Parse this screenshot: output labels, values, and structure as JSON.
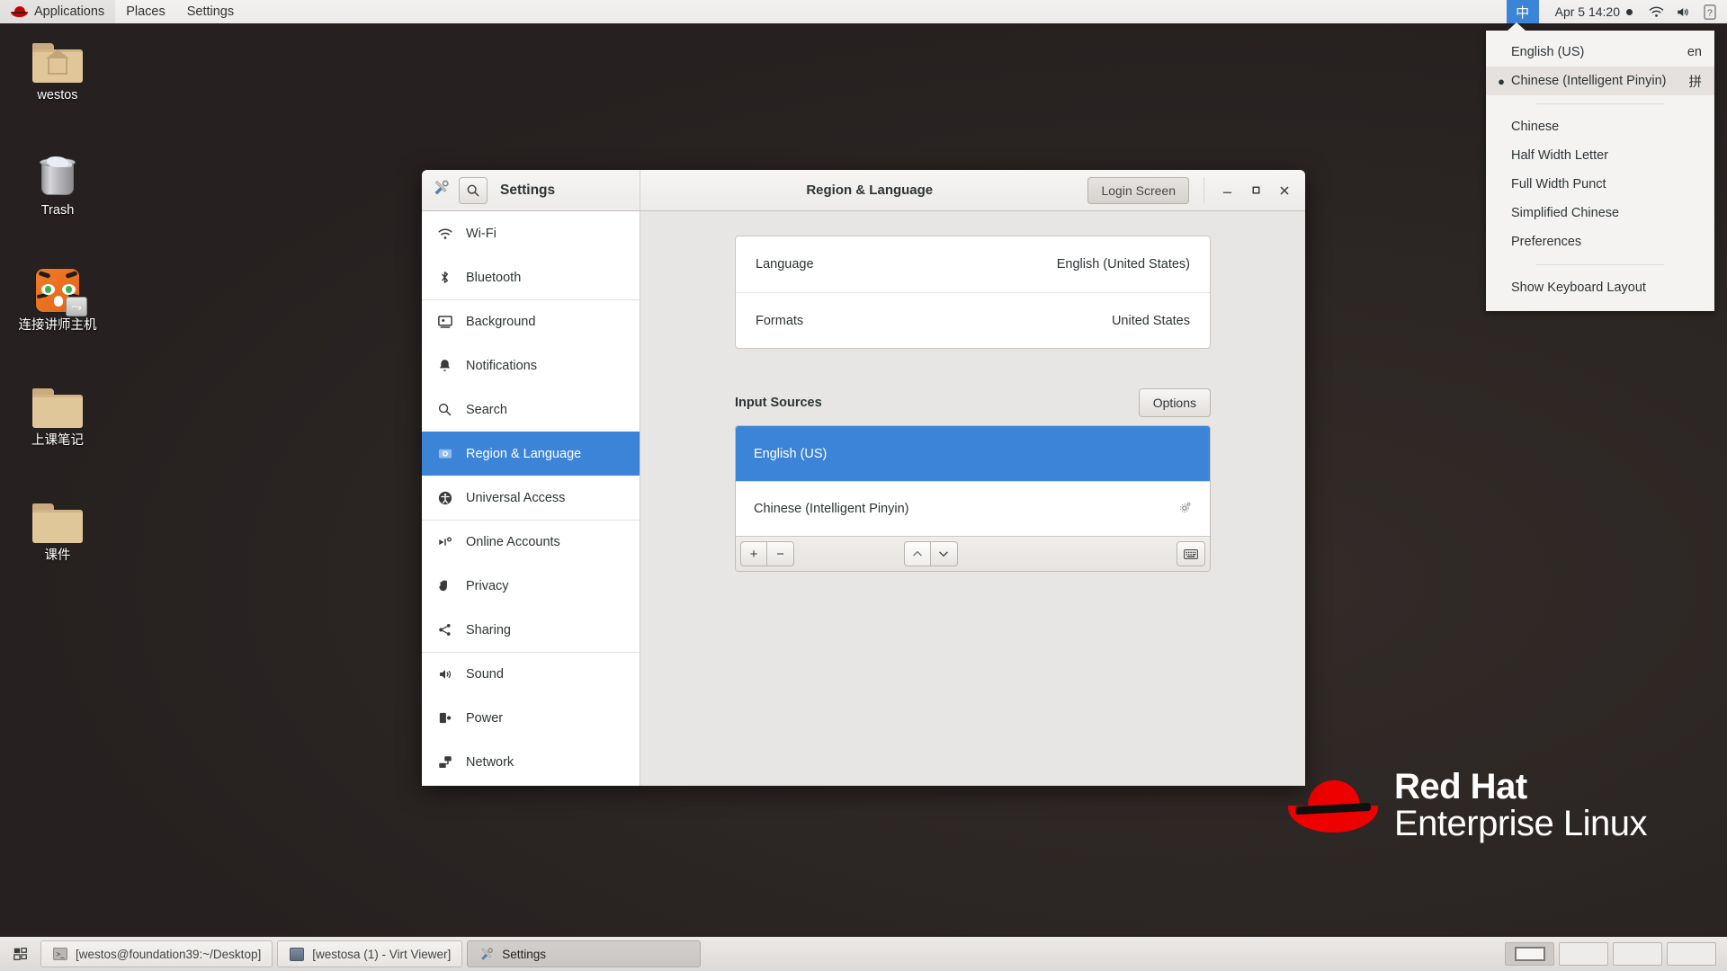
{
  "topbar": {
    "logo_icon": "redhat-logo-icon",
    "menus": [
      {
        "label": "Applications"
      },
      {
        "label": "Places"
      },
      {
        "label": "Settings"
      }
    ],
    "ime_indicator": "中",
    "clock": "Apr 5  14:20",
    "recording_dot": "●",
    "status_icons": [
      "wifi-icon",
      "volume-icon",
      "help-icon"
    ]
  },
  "ime_menu": {
    "sources": [
      {
        "label": "English (US)",
        "code": "en",
        "selected": false,
        "bullet": ""
      },
      {
        "label": "Chinese (Intelligent Pinyin)",
        "code": "拼",
        "selected": true,
        "bullet": "●"
      }
    ],
    "options": [
      {
        "label": "Chinese"
      },
      {
        "label": "Half Width Letter"
      },
      {
        "label": "Full Width Punct"
      },
      {
        "label": "Simplified Chinese"
      },
      {
        "label": "Preferences"
      }
    ],
    "footer": {
      "label": "Show Keyboard Layout"
    }
  },
  "desktop": {
    "icons": [
      {
        "name": "westos",
        "type": "home-folder"
      },
      {
        "name": "Trash",
        "type": "trash"
      },
      {
        "name": "连接讲师主机",
        "type": "app-shortcut"
      },
      {
        "name": "上课笔记",
        "type": "folder"
      },
      {
        "name": "课件",
        "type": "folder"
      }
    ],
    "brand": {
      "line1": "Red Hat",
      "line2": "Enterprise Linux"
    }
  },
  "settings_window": {
    "app_title": "Settings",
    "panel_title": "Region & Language",
    "login_screen_button": "Login Screen",
    "window_controls": {
      "minimize": "—",
      "maximize": "◻",
      "close": "✕"
    },
    "sidebar": [
      {
        "label": "Wi-Fi",
        "icon": "wifi-icon",
        "active": false,
        "separator_above": false
      },
      {
        "label": "Bluetooth",
        "icon": "bluetooth-icon",
        "active": false,
        "separator_above": false
      },
      {
        "label": "Background",
        "icon": "background-icon",
        "active": false,
        "separator_above": true
      },
      {
        "label": "Notifications",
        "icon": "bell-icon",
        "active": false,
        "separator_above": false
      },
      {
        "label": "Search",
        "icon": "search-icon",
        "active": false,
        "separator_above": false
      },
      {
        "label": "Region & Language",
        "icon": "region-language-icon",
        "active": true,
        "separator_above": false
      },
      {
        "label": "Universal Access",
        "icon": "universal-access-icon",
        "active": false,
        "separator_above": false
      },
      {
        "label": "Online Accounts",
        "icon": "online-accounts-icon",
        "active": false,
        "separator_above": true
      },
      {
        "label": "Privacy",
        "icon": "privacy-hand-icon",
        "active": false,
        "separator_above": false
      },
      {
        "label": "Sharing",
        "icon": "sharing-icon",
        "active": false,
        "separator_above": false
      },
      {
        "label": "Sound",
        "icon": "sound-icon",
        "active": false,
        "separator_above": true
      },
      {
        "label": "Power",
        "icon": "power-battery-icon",
        "active": false,
        "separator_above": false
      },
      {
        "label": "Network",
        "icon": "network-icon",
        "active": false,
        "separator_above": false
      }
    ],
    "content": {
      "language_row": {
        "label": "Language",
        "value": "English (United States)"
      },
      "formats_row": {
        "label": "Formats",
        "value": "United States"
      },
      "input_sources": {
        "heading": "Input Sources",
        "options_button": "Options",
        "rows": [
          {
            "label": "English (US)",
            "selected": true,
            "has_gear": false
          },
          {
            "label": "Chinese (Intelligent Pinyin)",
            "selected": false,
            "has_gear": true
          }
        ],
        "toolbar": {
          "add": "+",
          "remove": "−",
          "move_up": "move-up-icon",
          "move_down": "move-down-icon",
          "keyboard": "keyboard-icon"
        }
      }
    }
  },
  "taskbar": {
    "show_desktop_icon": "show-desktop-icon",
    "tasks": [
      {
        "label": "[westos@foundation39:~/Desktop]",
        "icon": "terminal-icon",
        "active": false
      },
      {
        "label": "[westosa (1) - Virt Viewer]",
        "icon": "virt-viewer-icon",
        "active": false
      },
      {
        "label": "Settings",
        "icon": "settings-tools-icon",
        "active": true
      }
    ],
    "workspaces": [
      {
        "active": true
      },
      {
        "active": false
      },
      {
        "active": false
      },
      {
        "active": false
      }
    ]
  },
  "colors": {
    "accent_blue": "#3c84d8",
    "redhat_red": "#ee0000",
    "desktop_bg": "#2a2422",
    "panel_bg": "#f6f5f4"
  }
}
